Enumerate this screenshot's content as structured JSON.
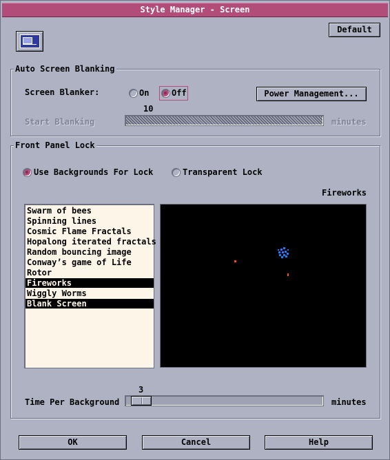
{
  "window": {
    "title": "Style Manager - Screen"
  },
  "toolbar": {
    "default_label": "Default"
  },
  "auto_blanking": {
    "title": "Auto Screen Blanking",
    "blanker_label": "Screen Blanker:",
    "on_label": "On",
    "off_label": "Off",
    "selected": "Off",
    "power_label": "Power Management...",
    "start_value": "10",
    "start_label": "Start Blanking",
    "start_units": "minutes"
  },
  "lock": {
    "title": "Front Panel Lock",
    "use_bg_label": "Use Backgrounds For Lock",
    "transparent_label": "Transparent Lock",
    "selected": "Use Backgrounds For Lock",
    "preview_label": "Fireworks",
    "items": [
      {
        "label": "Swarm of bees",
        "selected": false
      },
      {
        "label": "Spinning lines",
        "selected": false
      },
      {
        "label": "Cosmic Flame Fractals",
        "selected": false
      },
      {
        "label": "Hopalong iterated fractals",
        "selected": false
      },
      {
        "label": "Random bouncing image",
        "selected": false
      },
      {
        "label": "Conway’s game of Life",
        "selected": false
      },
      {
        "label": "Rotor",
        "selected": false
      },
      {
        "label": "Fireworks",
        "selected": true
      },
      {
        "label": "Wiggly Worms",
        "selected": false
      },
      {
        "label": "Blank Screen",
        "selected": true
      }
    ],
    "time_value": "3",
    "time_label": "Time Per Background",
    "time_units": "minutes"
  },
  "buttons": {
    "ok": "OK",
    "cancel": "Cancel",
    "help": "Help"
  },
  "colors": {
    "accent": "#b24d7a",
    "background": "#aeb2c3",
    "list_bg": "#fdf6e8",
    "firework_blue": "#1e7bff",
    "firework_orange": "#ff4a12"
  }
}
